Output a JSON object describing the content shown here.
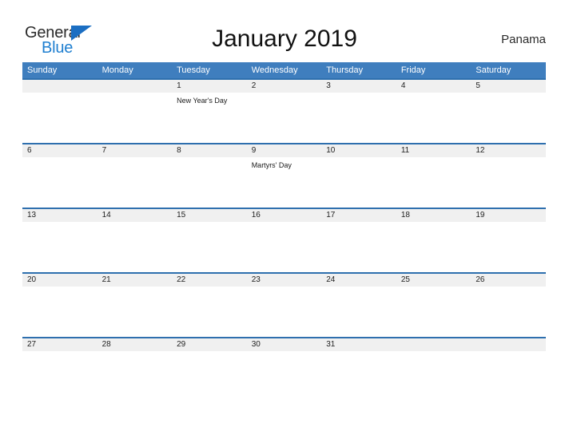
{
  "branding": {
    "logo_text_top": "General",
    "logo_text_bottom": "Blue",
    "logo_icon": "triangle-icon",
    "primary_color": "#1b6ec2",
    "text_color": "#2b2b2b"
  },
  "header": {
    "title": "January 2019",
    "region": "Panama",
    "header_bg_color": "#3f7ebe",
    "row_divider_color": "#2e6fae",
    "date_band_color": "#f0f0f0"
  },
  "calendar": {
    "weekday_names": [
      "Sunday",
      "Monday",
      "Tuesday",
      "Wednesday",
      "Thursday",
      "Friday",
      "Saturday"
    ],
    "weeks": [
      [
        {
          "date": "",
          "event": ""
        },
        {
          "date": "",
          "event": ""
        },
        {
          "date": "1",
          "event": "New Year's Day"
        },
        {
          "date": "2",
          "event": ""
        },
        {
          "date": "3",
          "event": ""
        },
        {
          "date": "4",
          "event": ""
        },
        {
          "date": "5",
          "event": ""
        }
      ],
      [
        {
          "date": "6",
          "event": ""
        },
        {
          "date": "7",
          "event": ""
        },
        {
          "date": "8",
          "event": ""
        },
        {
          "date": "9",
          "event": "Martyrs' Day"
        },
        {
          "date": "10",
          "event": ""
        },
        {
          "date": "11",
          "event": ""
        },
        {
          "date": "12",
          "event": ""
        }
      ],
      [
        {
          "date": "13",
          "event": ""
        },
        {
          "date": "14",
          "event": ""
        },
        {
          "date": "15",
          "event": ""
        },
        {
          "date": "16",
          "event": ""
        },
        {
          "date": "17",
          "event": ""
        },
        {
          "date": "18",
          "event": ""
        },
        {
          "date": "19",
          "event": ""
        }
      ],
      [
        {
          "date": "20",
          "event": ""
        },
        {
          "date": "21",
          "event": ""
        },
        {
          "date": "22",
          "event": ""
        },
        {
          "date": "23",
          "event": ""
        },
        {
          "date": "24",
          "event": ""
        },
        {
          "date": "25",
          "event": ""
        },
        {
          "date": "26",
          "event": ""
        }
      ],
      [
        {
          "date": "27",
          "event": ""
        },
        {
          "date": "28",
          "event": ""
        },
        {
          "date": "29",
          "event": ""
        },
        {
          "date": "30",
          "event": ""
        },
        {
          "date": "31",
          "event": ""
        },
        {
          "date": "",
          "event": ""
        },
        {
          "date": "",
          "event": ""
        }
      ]
    ]
  }
}
